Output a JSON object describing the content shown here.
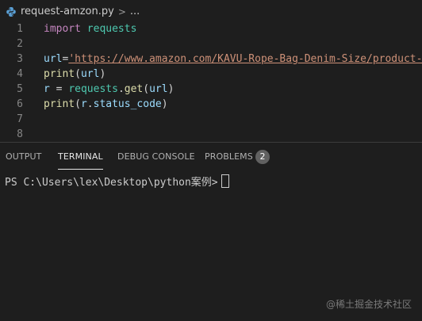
{
  "breadcrumb": {
    "file_name": "request-amzon.py",
    "separator": ">",
    "more": "..."
  },
  "editor": {
    "lines": [
      {
        "number": "1",
        "tokens": [
          [
            "kw",
            "import"
          ],
          [
            "plain",
            " "
          ],
          [
            "mod",
            "requests"
          ]
        ]
      },
      {
        "number": "2",
        "tokens": []
      },
      {
        "number": "3",
        "tokens": [
          [
            "var",
            "url"
          ],
          [
            "plain",
            "="
          ],
          [
            "str",
            "'https://www.amazon.com/KAVU-Rope-Bag-Denim-Size/product-r"
          ]
        ]
      },
      {
        "number": "4",
        "tokens": [
          [
            "fn",
            "print"
          ],
          [
            "plain",
            "("
          ],
          [
            "var",
            "url"
          ],
          [
            "plain",
            ")"
          ]
        ]
      },
      {
        "number": "5",
        "tokens": [
          [
            "var",
            "r"
          ],
          [
            "plain",
            " = "
          ],
          [
            "mod",
            "requests"
          ],
          [
            "plain",
            "."
          ],
          [
            "fn",
            "get"
          ],
          [
            "plain",
            "("
          ],
          [
            "var",
            "url"
          ],
          [
            "plain",
            ")"
          ]
        ]
      },
      {
        "number": "6",
        "tokens": [
          [
            "fn",
            "print"
          ],
          [
            "plain",
            "("
          ],
          [
            "var",
            "r"
          ],
          [
            "plain",
            "."
          ],
          [
            "var",
            "status_code"
          ],
          [
            "plain",
            ")"
          ]
        ]
      },
      {
        "number": "7",
        "tokens": []
      },
      {
        "number": "8",
        "tokens": []
      }
    ]
  },
  "panel": {
    "tabs": {
      "output": "OUTPUT",
      "terminal": "TERMINAL",
      "debug_console": "DEBUG CONSOLE",
      "problems": "PROBLEMS"
    },
    "active_tab": "TERMINAL",
    "problems_count": "2"
  },
  "terminal": {
    "prompt": "PS C:\\Users\\lex\\Desktop\\python案例>"
  },
  "watermark": "@稀土掘金技术社区",
  "colors": {
    "background": "#1e1e1e",
    "keyword": "#c586c0",
    "module": "#4ec9b0",
    "string": "#ce9178",
    "function": "#dcdcaa",
    "variable": "#9cdcfe"
  },
  "icons": {
    "file_icon": "python-file-icon"
  }
}
